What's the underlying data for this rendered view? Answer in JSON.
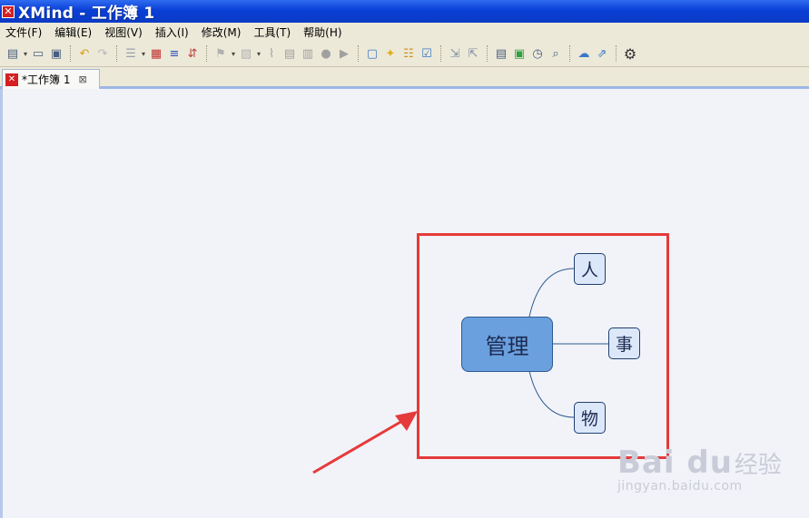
{
  "window": {
    "title": "XMind - 工作簿 1",
    "logo_glyph": "✕"
  },
  "menu": [
    "文件(F)",
    "编辑(E)",
    "视图(V)",
    "插入(I)",
    "修改(M)",
    "工具(T)",
    "帮助(H)"
  ],
  "tab": {
    "label": "*工作簿  1",
    "close_glyph": "⊠"
  },
  "mindmap": {
    "central": "管理",
    "subtopics": [
      "人",
      "事",
      "物"
    ]
  },
  "watermark": {
    "logo": "Bai du",
    "jingyan": "经验",
    "url": "jingyan.baidu.com"
  },
  "colors": {
    "highlight": "#e53a3a",
    "central_fill": "#6aa0de",
    "sub_fill": "#dce8fa",
    "titlebar": "#0a3fd6"
  }
}
